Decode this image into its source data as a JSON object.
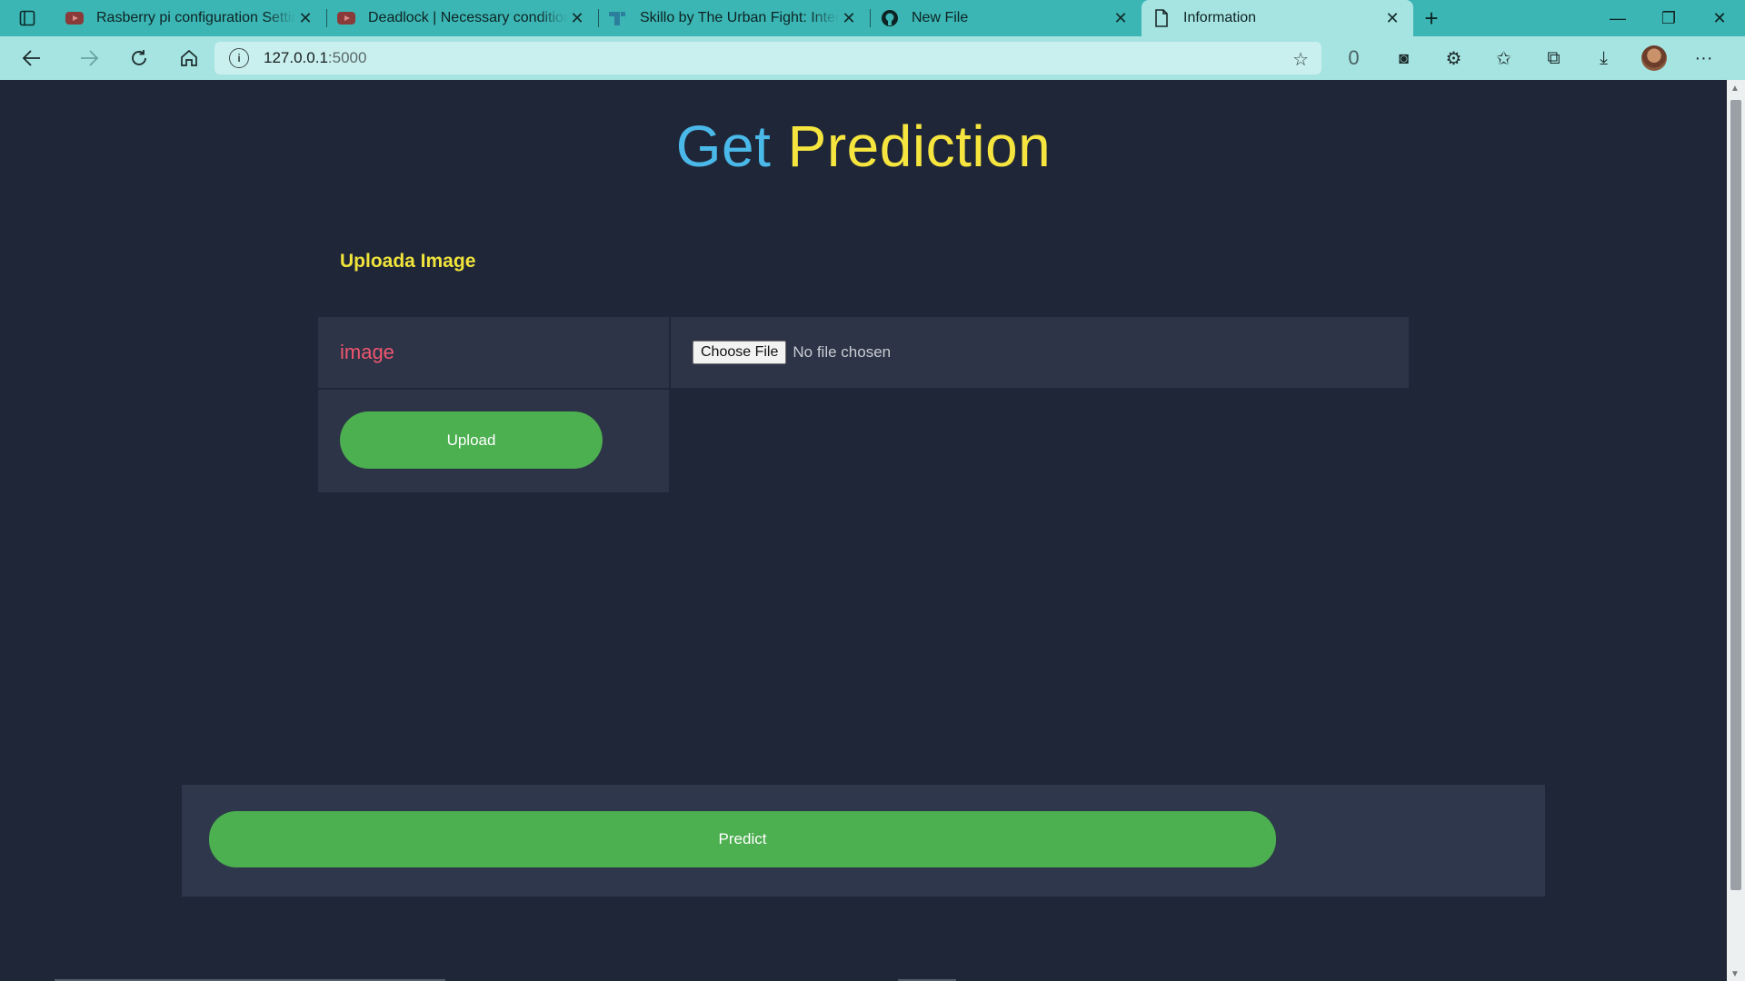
{
  "browser": {
    "tabs": [
      {
        "title": "Rasberry pi configuration Setting",
        "favicon": "youtube-icon"
      },
      {
        "title": "Deadlock | Necessary conditions",
        "favicon": "youtube-icon"
      },
      {
        "title": "Skillo by The Urban Fight: Interview",
        "favicon": "skillo-icon"
      },
      {
        "title": "New File",
        "favicon": "github-icon"
      },
      {
        "title": "Information",
        "favicon": "page-icon"
      }
    ],
    "address": {
      "host": "127.0.0.1",
      "port": ":5000"
    },
    "colors": {
      "tabbar": "#3bb6b4",
      "toolbar": "#a6e4e2"
    }
  },
  "page": {
    "title_part1": "Get",
    "title_part2": "Prediction",
    "subheading": "Uploada Image",
    "field_label": "image",
    "choose_file_label": "Choose File",
    "no_file_text": "No file chosen",
    "upload_label": "Upload",
    "predict_label": "Predict",
    "colors": {
      "background": "#1f2638",
      "panel": "#2d3447",
      "accent_button": "#4caf50",
      "title_blue": "#4ab8e8",
      "title_yellow": "#f5e53e",
      "label_pink": "#f0566f"
    }
  }
}
